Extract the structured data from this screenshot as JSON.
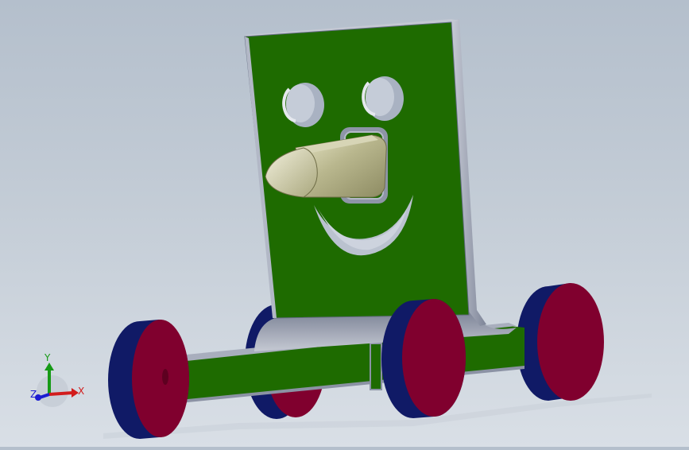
{
  "viewport": {
    "colors": {
      "background_top": "#b4bfcc",
      "background_bottom": "#d9dfe6",
      "plate_face": "#1e6b00",
      "plate_edge": "#9ca3b5",
      "wheel_tread": "#101a66",
      "wheel_face": "#80002e",
      "nose": "#a9a77d"
    }
  },
  "triad": {
    "x_label": "X",
    "y_label": "Y",
    "z_label": "Z",
    "x_color": "#d21c1c",
    "y_color": "#169a16",
    "z_color": "#1c1cd2"
  }
}
